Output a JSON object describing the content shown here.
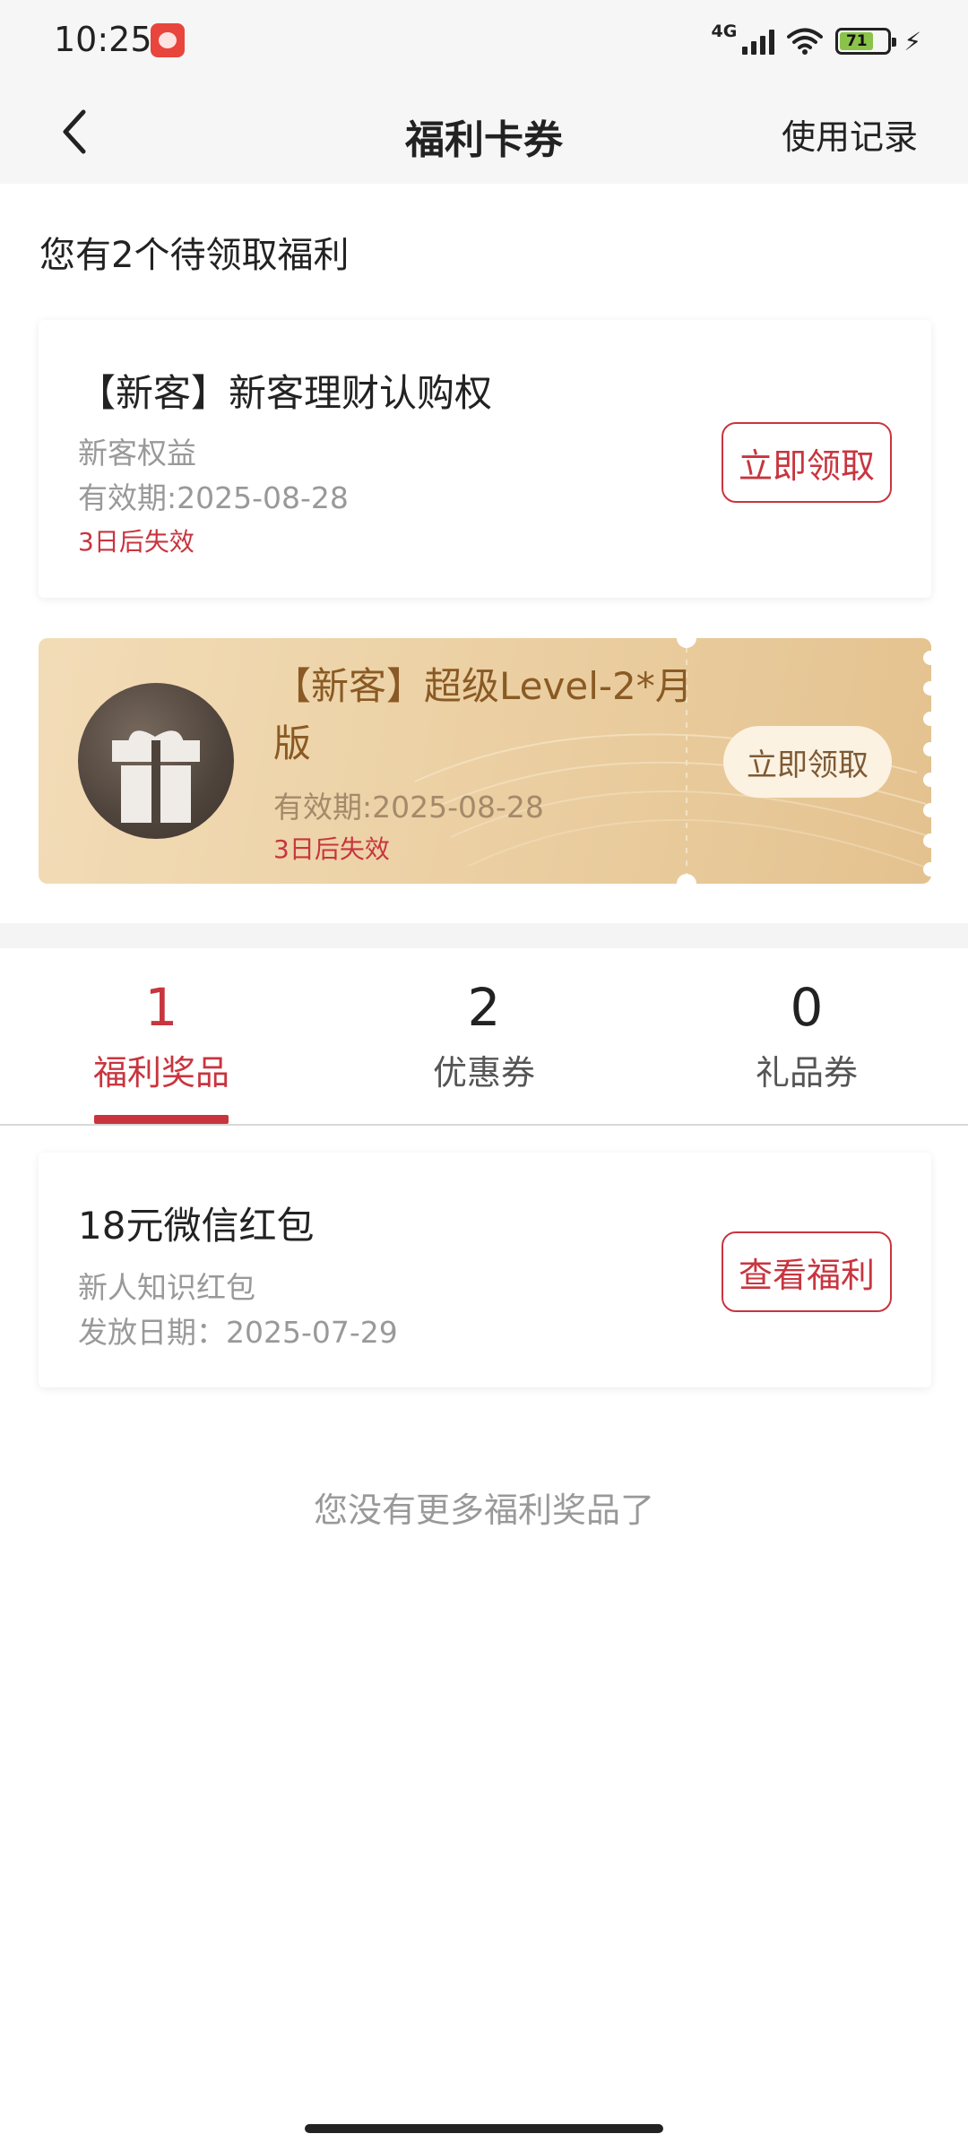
{
  "status_bar": {
    "time": "10:25",
    "network": "4G",
    "battery": "71",
    "icons": [
      "app-notification-icon",
      "signal-icon",
      "wifi-icon",
      "battery-icon",
      "charging-icon"
    ]
  },
  "nav": {
    "title": "福利卡券",
    "action": "使用记录",
    "back_icon": "chevron-left-icon"
  },
  "pending": {
    "heading": "您有2个待领取福利",
    "items": [
      {
        "title": "【新客】新客理财认购权",
        "subtitle": "新客权益",
        "validity": "有效期:2025-08-28",
        "warning": "3日后失效",
        "button": "立即领取"
      },
      {
        "title": "【新客】超级Level-2*月版",
        "validity": "有效期:2025-08-28",
        "warning": "3日后失效",
        "button": "立即领取",
        "icon": "gift-icon"
      }
    ]
  },
  "tabs": [
    {
      "count": "1",
      "label": "福利奖品",
      "active": true
    },
    {
      "count": "2",
      "label": "优惠券",
      "active": false
    },
    {
      "count": "0",
      "label": "礼品券",
      "active": false
    }
  ],
  "rewards": [
    {
      "title": "18元微信红包",
      "subtitle": "新人知识红包",
      "date": "发放日期：2025-07-29",
      "button": "查看福利"
    }
  ],
  "empty_hint": "您没有更多福利奖品了",
  "colors": {
    "accent": "#c8353f",
    "header_bg": "#f6f6f6",
    "ticket_gold": "#ecd1a5",
    "ticket_text": "#8a5a24"
  }
}
